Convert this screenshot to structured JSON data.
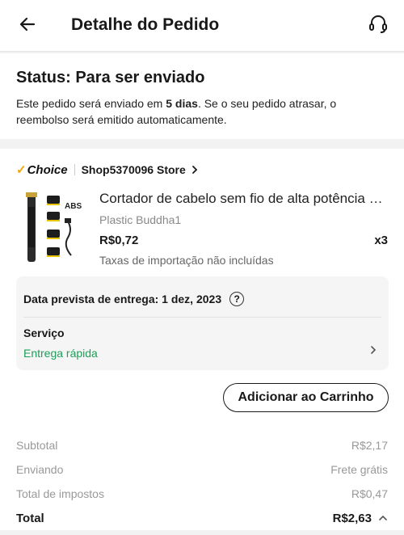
{
  "header": {
    "title": "Detalhe do Pedido",
    "back_icon": "arrow-left-icon",
    "support_icon": "headset-icon"
  },
  "status": {
    "title": "Status: Para ser enviado",
    "desc_pre": "Este pedido será enviado em ",
    "desc_bold": "5 dias",
    "desc_post": ". Se o seu pedido atrasar, o reembolso será emitido automaticamente."
  },
  "store": {
    "badge": "Choice",
    "name": "Shop5370096 Store"
  },
  "product": {
    "title": "Cortador de cabelo sem fio de alta potência para homens",
    "variant": "Plastic Buddha1",
    "price": "R$0,72",
    "qty": "x3",
    "tax_note": "Taxas de importação não incluídas",
    "image_label": "ABS"
  },
  "delivery": {
    "date": "Data prevista de entrega: 1 dez, 2023",
    "help": "?",
    "service_label": "Serviço",
    "service_value": "Entrega rápida"
  },
  "actions": {
    "add_to_cart": "Adicionar ao Carrinho"
  },
  "summary": {
    "rows": [
      {
        "label": "Subtotal",
        "value": "R$2,17"
      },
      {
        "label": "Enviando",
        "value": "Frete grátis"
      },
      {
        "label": "Total de impostos",
        "value": "R$0,47"
      }
    ],
    "total_label": "Total",
    "total_value": "R$2,63"
  },
  "colors": {
    "accent_green": "#1e9e5a",
    "choice_gold": "#f7a400"
  }
}
